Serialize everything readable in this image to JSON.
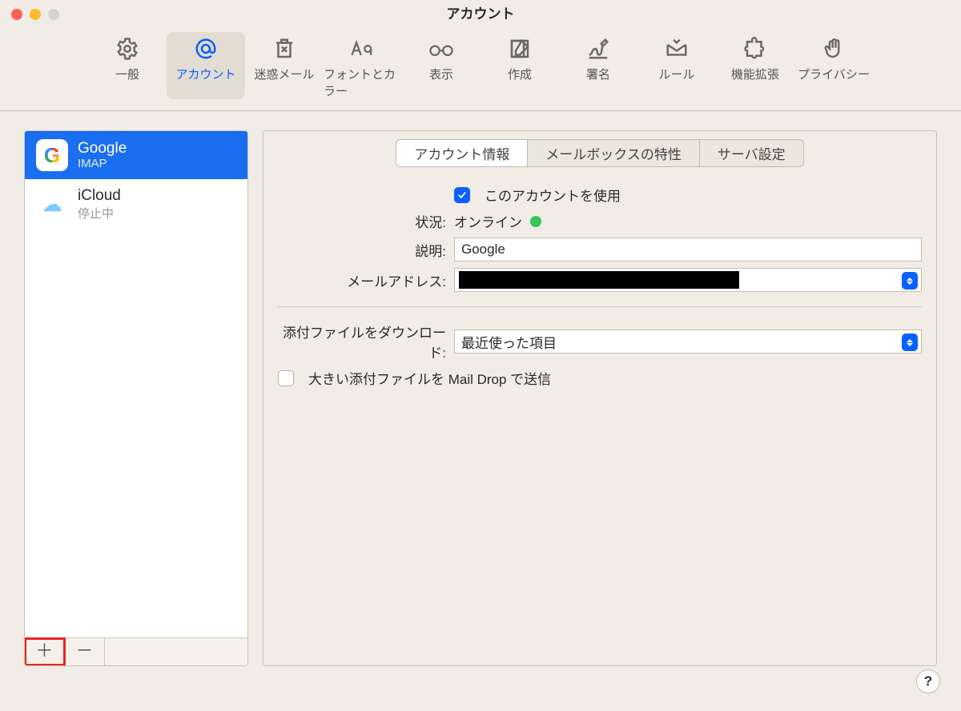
{
  "window": {
    "title": "アカウント"
  },
  "toolbar": {
    "items": [
      {
        "label": "一般"
      },
      {
        "label": "アカウント"
      },
      {
        "label": "迷惑メール"
      },
      {
        "label": "フォントとカラー"
      },
      {
        "label": "表示"
      },
      {
        "label": "作成"
      },
      {
        "label": "署名"
      },
      {
        "label": "ルール"
      },
      {
        "label": "機能拡張"
      },
      {
        "label": "プライバシー"
      }
    ]
  },
  "sidebar": {
    "accounts": [
      {
        "name": "Google",
        "sub": "IMAP"
      },
      {
        "name": "iCloud",
        "sub": "停止中"
      }
    ]
  },
  "tabs": {
    "info": "アカウント情報",
    "mailbox": "メールボックスの特性",
    "server": "サーバ設定"
  },
  "form": {
    "enable_label": "このアカウントを使用",
    "status_label": "状況:",
    "status_value": "オンライン",
    "desc_label": "説明:",
    "desc_value": "Google",
    "email_label": "メールアドレス:",
    "download_label": "添付ファイルをダウンロード:",
    "download_value": "最近使った項目",
    "maildrop_label": "大きい添付ファイルを Mail Drop で送信"
  },
  "help": "?"
}
